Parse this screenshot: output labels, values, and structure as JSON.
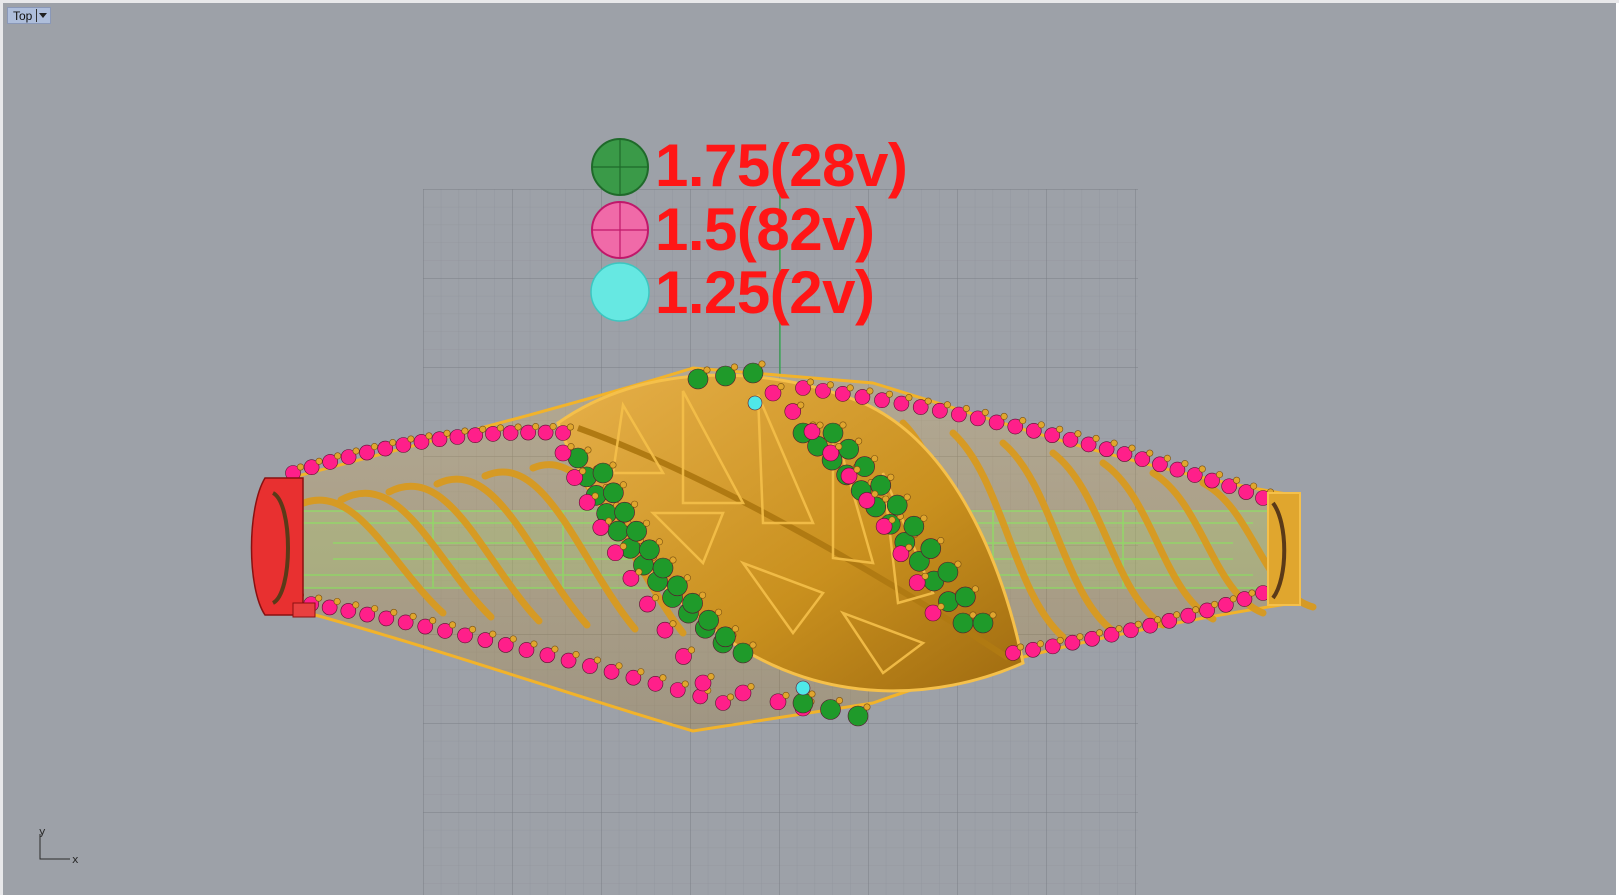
{
  "viewport": {
    "name": "Top",
    "background": "#9da1a8"
  },
  "legend": [
    {
      "size_label": "1.75(28v)",
      "color": "#2a9a3a",
      "icon": "crosshair-circle-icon"
    },
    {
      "size_label": "1.5(82v)",
      "color": "#f06aa8",
      "icon": "crosshair-circle-icon"
    },
    {
      "size_label": "1.25(2v)",
      "color": "#5fe8e0",
      "icon": "filled-circle-icon"
    }
  ],
  "axes": {
    "x_label": "x",
    "y_label": "y"
  },
  "model": {
    "metal_color": "#e0a62e",
    "gem_colors": {
      "green": "#1f9a2a",
      "pink": "#ff1f8a",
      "cyan": "#4fe8e8"
    },
    "clasp_color": "#e83030"
  }
}
